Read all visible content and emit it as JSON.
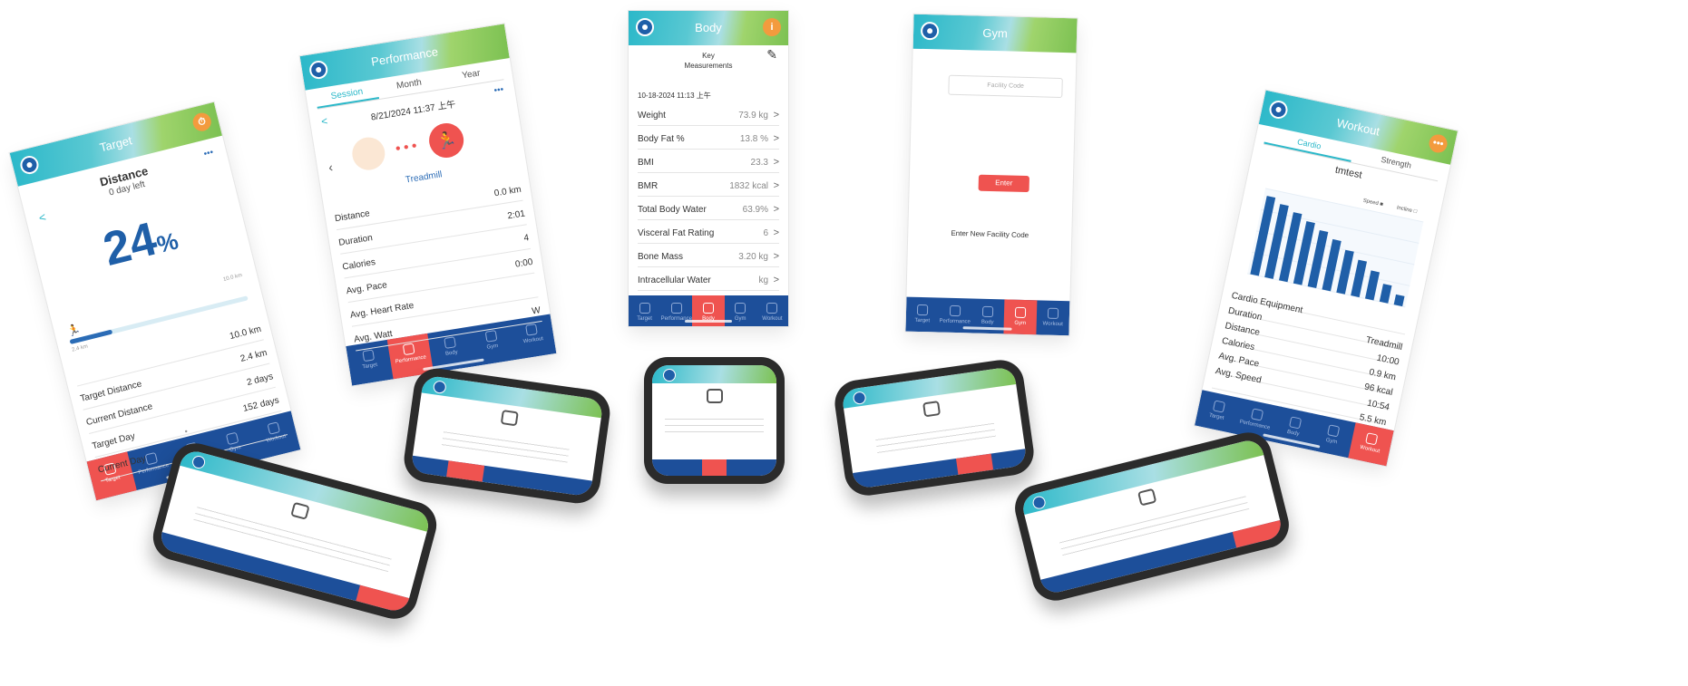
{
  "target": {
    "title": "Target",
    "label": "Distance",
    "days_left": "0 day left",
    "percent": "24",
    "percent_unit": "%",
    "bar_end_label": "10.0 km",
    "bar_start_label": "2.4 km",
    "progress": 0.24,
    "rows": [
      {
        "label": "",
        "value": "10.0 km"
      },
      {
        "label": "Target Distance",
        "value": "2.4 km"
      },
      {
        "label": "Current Distance",
        "value": "2 days"
      },
      {
        "label": "Target Day",
        "value": "152 days"
      },
      {
        "label": "Current Day",
        "value": ""
      }
    ],
    "more": "•••"
  },
  "performance": {
    "title": "Performance",
    "tabs": [
      "Session",
      "Month",
      "Year"
    ],
    "timestamp": "8/21/2024 11:37 上午",
    "activity": "Treadmill",
    "more": "•••",
    "rows": [
      {
        "label": "Distance",
        "value": "0.0 km"
      },
      {
        "label": "Duration",
        "value": "2:01"
      },
      {
        "label": "Calories",
        "value": "4"
      },
      {
        "label": "Avg. Pace",
        "value": "0:00"
      },
      {
        "label": "Avg. Heart Rate",
        "value": ""
      },
      {
        "label": "Avg. Watt",
        "value": "W"
      }
    ]
  },
  "body": {
    "title": "Body",
    "info": "i",
    "section": "Key\nMeasurements",
    "timestamp": "10-18-2024 11:13 上午",
    "rows": [
      {
        "label": "Weight",
        "value": "73.9 kg"
      },
      {
        "label": "Body Fat %",
        "value": "13.8 %"
      },
      {
        "label": "BMI",
        "value": "23.3"
      },
      {
        "label": "BMR",
        "value": "1832 kcal"
      },
      {
        "label": "Total Body Water",
        "value": "63.9%"
      },
      {
        "label": "Visceral Fat Rating",
        "value": "6"
      },
      {
        "label": "Bone Mass",
        "value": "3.20 kg"
      },
      {
        "label": "Intracellular Water",
        "value": "kg"
      }
    ],
    "chevron": ">",
    "dots": "• • •"
  },
  "gym": {
    "title": "Gym",
    "placeholder": "Facility Code",
    "enter_label": "Enter",
    "hint": "Enter New Facility Code",
    "dots": "• •"
  },
  "workout": {
    "title": "Workout",
    "tabs": [
      "Cardio",
      "Strength"
    ],
    "user": "tmtest",
    "legend": [
      "Speed",
      "Incline"
    ],
    "rows": [
      {
        "label": "Cardio Equipment",
        "value": ""
      },
      {
        "label": "Duration",
        "value": "Treadmill"
      },
      {
        "label": "Distance",
        "value": "10:00"
      },
      {
        "label": "Calories",
        "value": "0.9 km"
      },
      {
        "label": "Avg. Pace",
        "value": "96 kcal"
      },
      {
        "label": "Avg. Speed",
        "value": "10:54"
      },
      {
        "label": "",
        "value": "5.5 km"
      }
    ],
    "dots": "• • • • • •"
  },
  "chart_data": {
    "type": "bar",
    "series": [
      {
        "name": "Speed",
        "values": [
          9.2,
          8.6,
          8.0,
          7.3,
          6.6,
          5.9,
          5.0,
          4.2,
          3.3,
          2.1,
          1.2
        ]
      }
    ],
    "legend": [
      "Speed",
      "Incline"
    ],
    "legend_position": "top-right",
    "grid": true
  },
  "tabs_bottom": [
    "Target",
    "Performance",
    "Body",
    "Gym",
    "Workout"
  ]
}
